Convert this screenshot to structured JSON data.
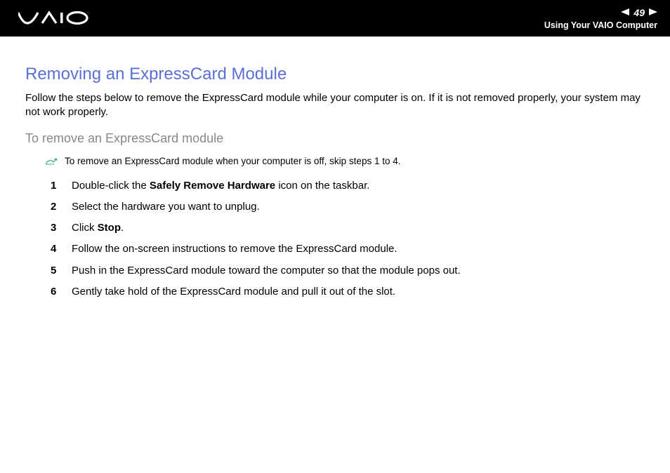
{
  "header": {
    "page_number": "49",
    "section_title": "Using Your VAIO Computer"
  },
  "content": {
    "main_heading": "Removing an ExpressCard Module",
    "intro_text": "Follow the steps below to remove the ExpressCard module while your computer is on. If it is not removed properly, your system may not work properly.",
    "sub_heading": "To remove an ExpressCard module",
    "note_text": "To remove an ExpressCard module when your computer is off, skip steps 1 to 4.",
    "steps": [
      {
        "num": "1",
        "pre": "Double-click the ",
        "bold": "Safely Remove Hardware",
        "post": " icon on the taskbar."
      },
      {
        "num": "2",
        "pre": "Select the hardware you want to unplug.",
        "bold": "",
        "post": ""
      },
      {
        "num": "3",
        "pre": "Click ",
        "bold": "Stop",
        "post": "."
      },
      {
        "num": "4",
        "pre": "Follow the on-screen instructions to remove the ExpressCard module.",
        "bold": "",
        "post": ""
      },
      {
        "num": "5",
        "pre": "Push in the ExpressCard module toward the computer so that the module pops out.",
        "bold": "",
        "post": ""
      },
      {
        "num": "6",
        "pre": "Gently take hold of the ExpressCard module and pull it out of the slot.",
        "bold": "",
        "post": ""
      }
    ]
  }
}
